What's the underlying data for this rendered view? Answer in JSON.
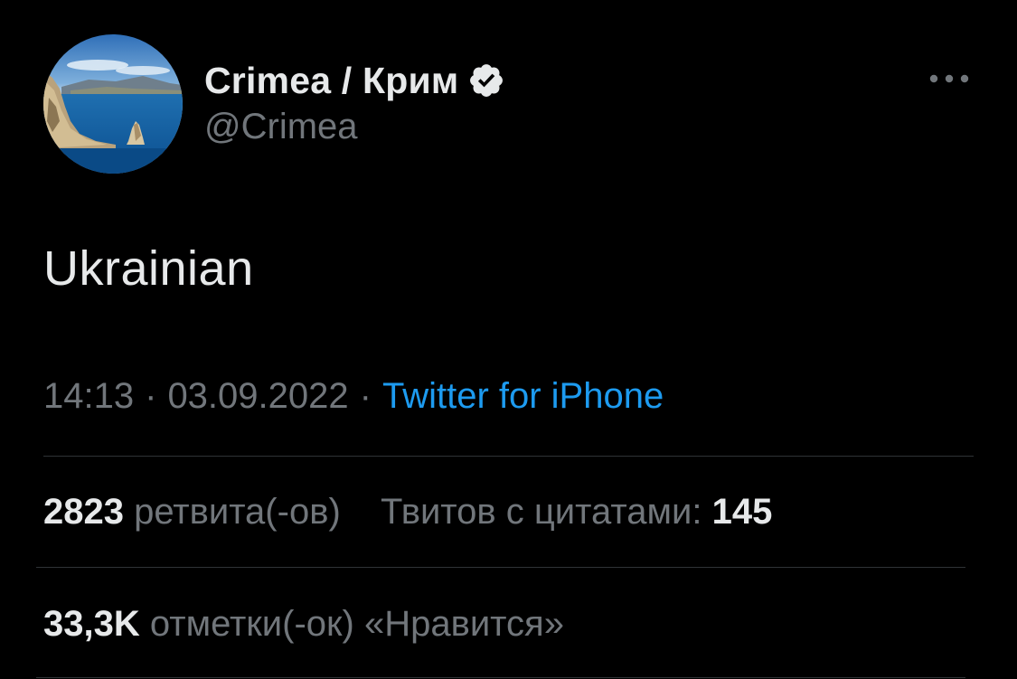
{
  "author": {
    "display_name": "Crimea / Крим",
    "handle": "@Crimea",
    "verified": true
  },
  "tweet": {
    "text": "Ukrainian",
    "time": "14:13",
    "date": "03.09.2022",
    "separator": "·",
    "source": "Twitter for iPhone"
  },
  "stats": {
    "retweets_count": "2823",
    "retweets_label": "ретвита(-ов)",
    "quotes_label": "Твитов с цитатами:",
    "quotes_count": "145",
    "likes_count": "33,3K",
    "likes_label": "отметки(-ок) «Нравится»"
  },
  "icons": {
    "avatar": "sea-rock-landscape-avatar",
    "verified": "verified-badge-icon",
    "more": "more-options-icon"
  },
  "colors": {
    "background": "#000000",
    "primary_text": "#e7e9ea",
    "secondary_text": "#71767b",
    "link": "#1d9bf0",
    "divider": "#2f3336"
  }
}
